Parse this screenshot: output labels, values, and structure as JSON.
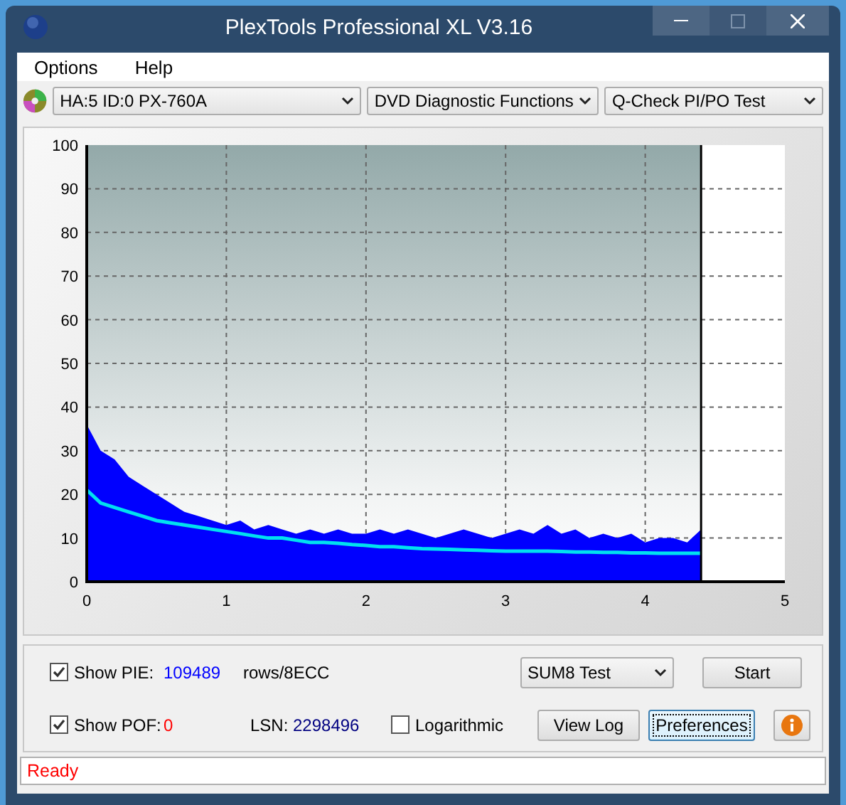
{
  "window": {
    "title": "PlexTools Professional XL V3.16"
  },
  "menu": [
    {
      "label": "Options"
    },
    {
      "label": "Help"
    }
  ],
  "toolbar": {
    "drive": "HA:5 ID:0  PX-760A",
    "function": "DVD Diagnostic Functions",
    "test": "Q-Check PI/PO Test"
  },
  "chart": {
    "chart_data": {
      "type": "area",
      "xlim": [
        0,
        5
      ],
      "ylim": [
        0,
        100
      ],
      "xticks": [
        0,
        1,
        2,
        3,
        4,
        5
      ],
      "yticks": [
        0,
        10,
        20,
        30,
        40,
        50,
        60,
        70,
        80,
        90,
        100
      ],
      "grid": true,
      "bands": [
        {
          "axis": "x",
          "from": 0,
          "to": 4.4
        }
      ],
      "ref_lines": [
        {
          "axis": "x",
          "value": 4.4,
          "color": "#000000"
        }
      ],
      "x": [
        0,
        0.1,
        0.2,
        0.3,
        0.4,
        0.5,
        0.6,
        0.7,
        0.8,
        0.9,
        1,
        1.1,
        1.2,
        1.3,
        1.4,
        1.5,
        1.6,
        1.7,
        1.8,
        1.9,
        2,
        2.1,
        2.2,
        2.3,
        2.4,
        2.5,
        2.6,
        2.7,
        2.8,
        2.9,
        3,
        3.1,
        3.2,
        3.3,
        3.4,
        3.5,
        3.6,
        3.7,
        3.8,
        3.9,
        4,
        4.1,
        4.2,
        4.3,
        4.4
      ],
      "series": [
        {
          "type": "area",
          "color": "#0000ff",
          "values": [
            36,
            30,
            28,
            24,
            22,
            20,
            18,
            16,
            15,
            14,
            13,
            14,
            12,
            13,
            12,
            11,
            12,
            11,
            12,
            11,
            11,
            12,
            11,
            12,
            11,
            10,
            11,
            12,
            11,
            10,
            11,
            12,
            11,
            13,
            11,
            12,
            10,
            11,
            10,
            11,
            9,
            10,
            10,
            9,
            12
          ]
        },
        {
          "type": "line",
          "color": "#00e0f0",
          "values": [
            21,
            18,
            17,
            16,
            15,
            14,
            13.5,
            13,
            12.5,
            12,
            11.5,
            11,
            10.5,
            10,
            10,
            9.5,
            9,
            9,
            8.8,
            8.5,
            8.3,
            8,
            8,
            7.8,
            7.6,
            7.5,
            7.4,
            7.3,
            7.2,
            7.1,
            7,
            7,
            7,
            7,
            6.9,
            6.8,
            6.8,
            6.7,
            6.7,
            6.6,
            6.6,
            6.5,
            6.5,
            6.5,
            6.5
          ]
        }
      ]
    }
  },
  "controls": {
    "show_pie": {
      "label": "Show PIE:",
      "checked": true,
      "value": "109489",
      "unit": "rows/8ECC"
    },
    "show_pof": {
      "label": "Show POF:",
      "checked": true,
      "value": "0"
    },
    "lsn": {
      "label": "LSN:",
      "value": "2298496"
    },
    "logarithmic": {
      "label": "Logarithmic",
      "checked": false
    },
    "test_mode": "SUM8 Test",
    "buttons": [
      {
        "label": "Start",
        "focused": false
      },
      {
        "label": "View Log",
        "focused": false
      },
      {
        "label": "Preferences",
        "focused": true
      }
    ]
  },
  "status_bar": "Ready"
}
